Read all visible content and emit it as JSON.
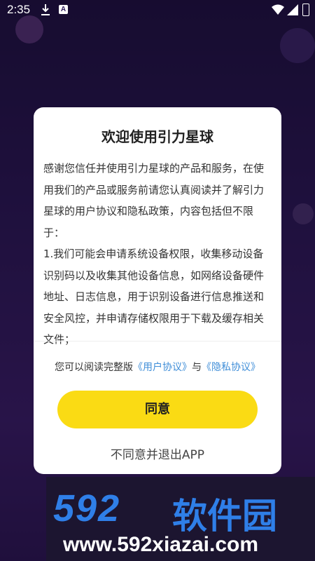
{
  "status_bar": {
    "time": "2:35",
    "a_badge": "A"
  },
  "dialog": {
    "title": "欢迎使用引力星球",
    "intro": "感谢您信任并使用引力星球的产品和服务，在使用我们的产品或服务前请您认真阅读并了解引力星球的用户协议和隐私政策，内容包括但不限于：",
    "item_1": " 1.我们可能会申请系统设备权限，收集移动设备识别码以及收集其他设备信息，如网络设备硬件地址、日志信息，用于识别设备进行信息推送和安全风控，并申请存储权限用于下载及缓存相关文件；",
    "agree_prefix": "您可以阅读完整版",
    "user_agreement_link": "《用户协议》",
    "and_text": "与",
    "privacy_link": "《隐私协议》",
    "agree_button": "同意",
    "decline_button": "不同意并退出APP"
  },
  "watermark": {
    "logo_digits": "592",
    "logo_cn": "软件园",
    "url": "www.592xiazai.com"
  },
  "colors": {
    "accent_yellow": "#fadb14",
    "link_blue": "#3f8ed8",
    "watermark_blue": "#2f7fe8"
  }
}
